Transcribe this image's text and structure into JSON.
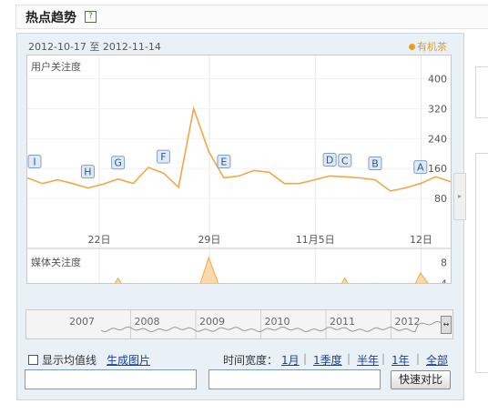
{
  "header": {
    "title": "热点趋势",
    "help_icon": "?"
  },
  "date_range": "2012-10-17 至 2012-11-14",
  "legend_label": "有机茶",
  "user_chart": {
    "label": "用户关注度",
    "y_ticks": [
      "400",
      "320",
      "240",
      "160",
      "80"
    ],
    "x_ticks": [
      "22日",
      "29日",
      "11月5日",
      "12日"
    ]
  },
  "media_chart": {
    "label": "媒体关注度",
    "y_ticks": [
      "8",
      "4"
    ]
  },
  "chart_data": [
    {
      "type": "line",
      "x": [
        "10-17",
        "10-18",
        "10-19",
        "10-20",
        "10-21",
        "10-22",
        "10-23",
        "10-24",
        "10-25",
        "10-26",
        "10-27",
        "10-28",
        "10-29",
        "10-30",
        "10-31",
        "11-01",
        "11-02",
        "11-03",
        "11-04",
        "11-05",
        "11-06",
        "11-07",
        "11-08",
        "11-09",
        "11-10",
        "11-11",
        "11-12",
        "11-13",
        "11-14"
      ],
      "values": [
        135,
        120,
        130,
        120,
        108,
        118,
        132,
        120,
        163,
        148,
        110,
        320,
        205,
        135,
        140,
        155,
        150,
        120,
        120,
        130,
        140,
        138,
        135,
        130,
        100,
        108,
        120,
        138,
        125
      ],
      "annotations": [
        "I",
        "H",
        "G",
        "F",
        "E",
        "D",
        "C",
        "B",
        "A"
      ],
      "ylim": [
        0,
        450
      ]
    },
    {
      "type": "area",
      "x": [
        "10-17",
        "10-18",
        "10-19",
        "10-20",
        "10-21",
        "10-22",
        "10-23",
        "10-24",
        "10-25",
        "10-26",
        "10-27",
        "10-28",
        "10-29",
        "10-30",
        "10-31",
        "11-01",
        "11-02",
        "11-03",
        "11-04",
        "11-05",
        "11-06",
        "11-07",
        "11-08",
        "11-09",
        "11-10",
        "11-11",
        "11-12",
        "11-13",
        "11-14"
      ],
      "values": [
        2,
        0,
        0,
        0,
        1,
        0,
        5,
        0,
        2,
        2,
        0,
        0,
        9,
        1,
        0,
        0,
        0,
        0,
        1,
        2,
        0,
        5,
        0,
        4,
        0,
        0,
        6,
        2,
        1
      ],
      "ylim": [
        0,
        9
      ]
    }
  ],
  "overview": {
    "years": [
      "2007",
      "2008",
      "2009",
      "2010",
      "2011",
      "2012"
    ]
  },
  "controls": {
    "show_avg_label": "显示均值线",
    "generate_image": "生成图片",
    "time_width_label": "时间宽度：",
    "range_1m": "1月",
    "range_1q": "1季度",
    "range_half": "半年",
    "range_1y": "1年",
    "range_all": "全部",
    "compare_button": "快速对比"
  },
  "colors": {
    "line": "#f0a844",
    "fill": "#fbd9a8",
    "legend": "#f59a1b",
    "link": "#1a3f9a"
  }
}
